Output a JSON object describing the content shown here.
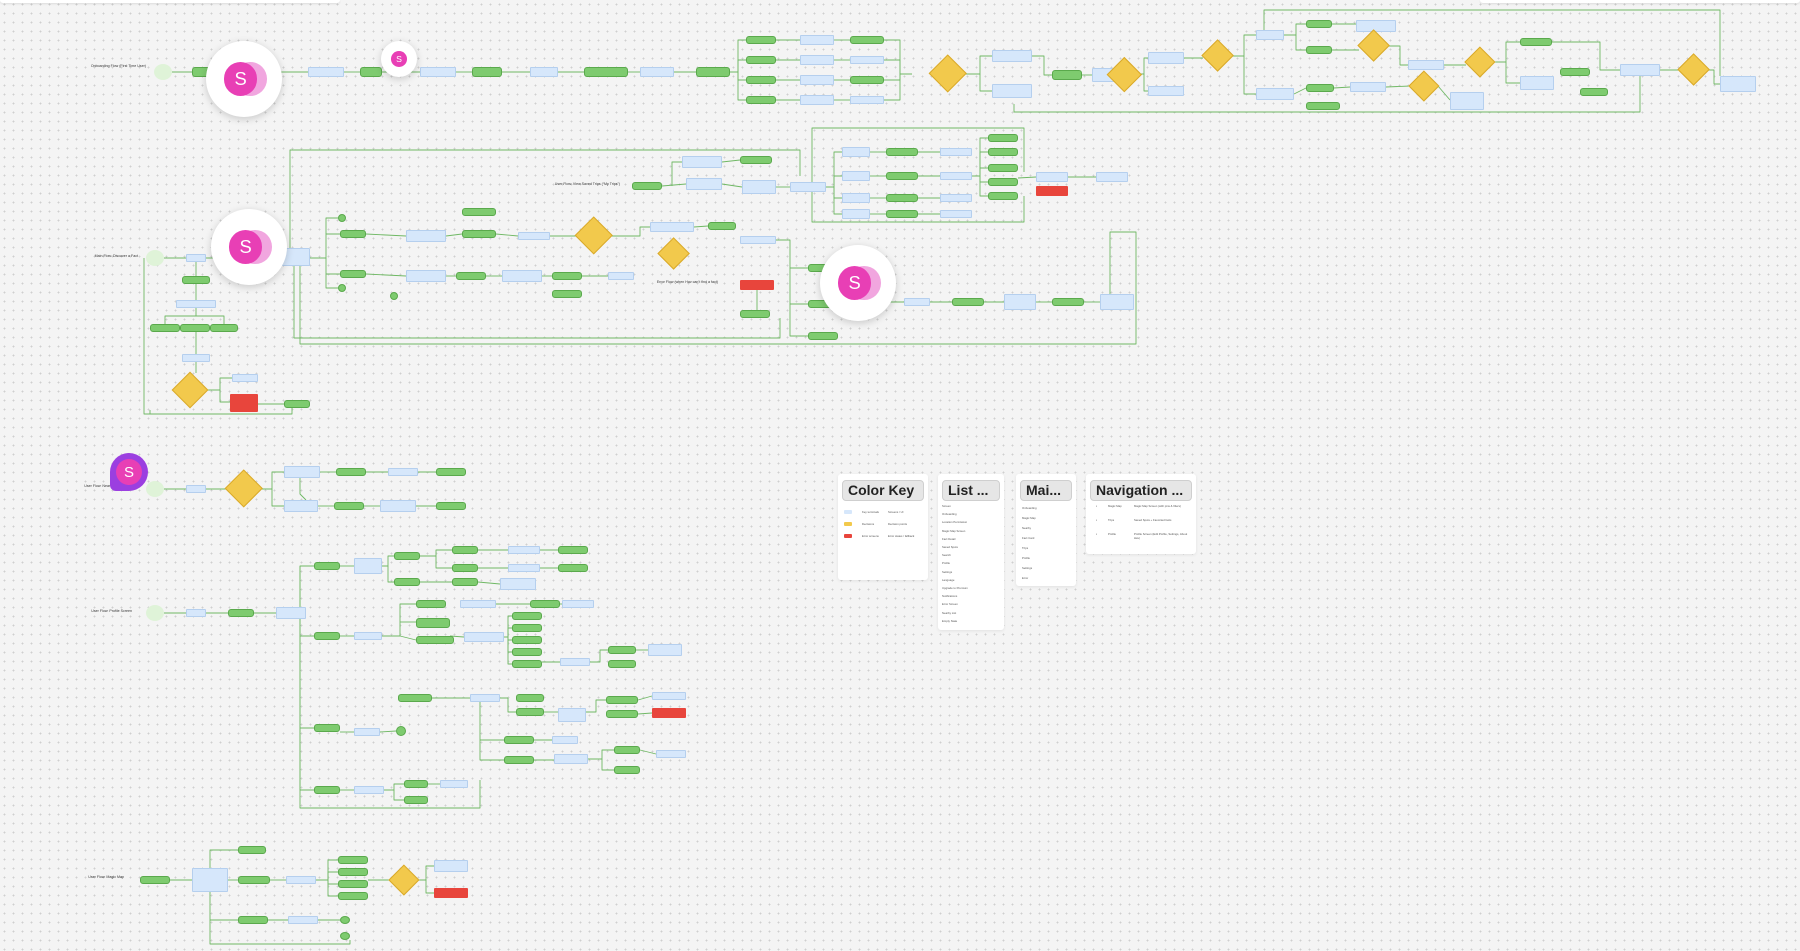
{
  "canvas": {
    "background": "#f4f4f4",
    "dot_color": "#cfcfcf"
  },
  "colors": {
    "terminal": "#7ecb6f",
    "process": "#d6e7fb",
    "decision": "#f2c94c",
    "error": "#e8453c",
    "edge": "#6fb864",
    "avatar": "#e83fb5",
    "cursor_badge": "#9b3fe0"
  },
  "flow_labels": {
    "onboarding": "Onboarding Flow (First Time User)",
    "saved_trips": "User Flow: View Saved Trips (“My Trips”)",
    "main": "Main Flow: Discover a Fact",
    "error": "Error Flow (when Hav can’t find a fact)",
    "nearby": "User Flow: Nearby",
    "profile": "User Flow: Profile Screen",
    "settings": "User Flow: Magic Map"
  },
  "avatar_initial": "S",
  "legends": {
    "color_key": {
      "title": "Color Key",
      "rows": [
        "Key terminals",
        "Decisions",
        "Error screens",
        "Screens / UI",
        "Decision points",
        "Error states / fallback"
      ]
    },
    "list": {
      "title": "List ...",
      "rows": [
        "Screen",
        "Onboarding",
        "Location Permission",
        "Magic Map Screen",
        "Fact Detail",
        "Saved Spots",
        "Search",
        "Profile",
        "Settings",
        "Language",
        "Upgrade to Premium",
        "Notifications",
        "Error Screen",
        "Nearby List",
        "Empty State"
      ]
    },
    "main_list": {
      "title": "Mai...",
      "rows": [
        "Onboarding",
        "Magic Map",
        "Nearby",
        "Fact Card",
        "Trips",
        "Profile",
        "Settings",
        "Error"
      ]
    },
    "navigation": {
      "title": "Navigation ...",
      "rows": [
        {
          "tab": "Magic Map",
          "desc": "Magic Map Screen (with pins & filters)"
        },
        {
          "tab": "Trips",
          "desc": "Saved Spots + Favorited facts"
        },
        {
          "tab": "Profile",
          "desc": "Profile Screen (Edit Profile, Settings, About Hav)"
        }
      ]
    }
  }
}
